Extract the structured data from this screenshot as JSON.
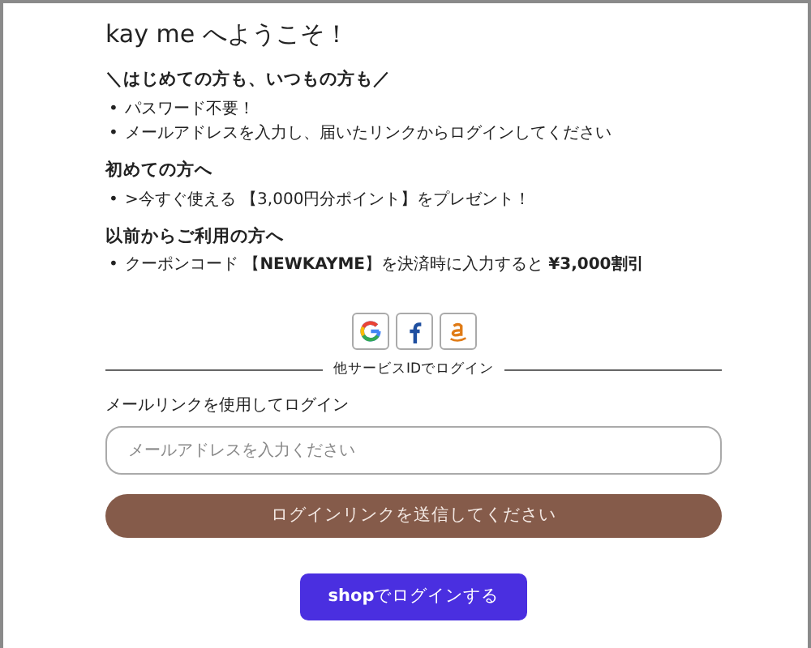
{
  "title": "kay me へようこそ！",
  "bullet": "•",
  "sections": [
    {
      "heading": "＼はじめての方も、いつもの方も／",
      "items": [
        "パスワード不要！",
        "メールアドレスを入力し、届いたリンクからログインしてください"
      ]
    },
    {
      "heading": "初めての方へ",
      "items": [
        ">今すぐ使える 【3,000円分ポイント】をプレゼント！"
      ]
    },
    {
      "heading": "以前からご利用の方へ",
      "items": [
        "クーポンコード 【**NEWKAYME**】を決済時に入力すると **¥3,000割引**"
      ]
    }
  ],
  "social_buttons": [
    {
      "kind": "google"
    },
    {
      "kind": "facebook"
    },
    {
      "kind": "amazon"
    }
  ],
  "divider_label": "他サービスIDでログイン",
  "email_label": "メールリンクを使用してログイン",
  "email_field": {
    "placeholder": "メールアドレスを入力ください"
  },
  "send_button": "ログインリンクを送信してください",
  "shop_button": "**shop**でログインする"
}
